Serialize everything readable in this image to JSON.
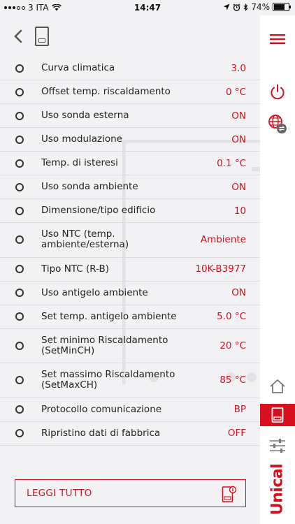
{
  "status_bar": {
    "carrier": "3 ITA",
    "time": "14:47",
    "battery_percent": "74%",
    "battery_level": 0.74
  },
  "settings": [
    {
      "label": "Curva climatica",
      "value": "3.0"
    },
    {
      "label": "Offset temp. riscaldamento",
      "value": "0 °C"
    },
    {
      "label": "Uso sonda esterna",
      "value": "ON"
    },
    {
      "label": "Uso modulazione",
      "value": "ON"
    },
    {
      "label": "Temp. di isteresi",
      "value": "0.1 °C"
    },
    {
      "label": "Uso sonda ambiente",
      "value": "ON"
    },
    {
      "label": "Dimensione/tipo edificio",
      "value": "10"
    },
    {
      "label": "Uso NTC (temp. ambiente/esterna)",
      "value": "Ambiente"
    },
    {
      "label": "Tipo NTC (R-B)",
      "value": "10K-B3977"
    },
    {
      "label": "Uso antigelo ambiente",
      "value": "ON"
    },
    {
      "label": "Set temp. antigelo ambiente",
      "value": "5.0 °C"
    },
    {
      "label": "Set minimo Riscaldamento (SetMinCH)",
      "value": "20 °C"
    },
    {
      "label": "Set massimo Riscaldamento (SetMaxCH)",
      "value": "85 °C"
    },
    {
      "label": "Protocollo comunicazione",
      "value": "BP"
    },
    {
      "label": "Ripristino dati di fabbrica",
      "value": "OFF"
    }
  ],
  "read_all_button": {
    "label": "LEGGI TUTTO"
  },
  "brand": {
    "logo_text": "Unical"
  },
  "colors": {
    "accent": "#d6101d",
    "background": "#f2f2f4",
    "sidebar": "#ffffff"
  }
}
